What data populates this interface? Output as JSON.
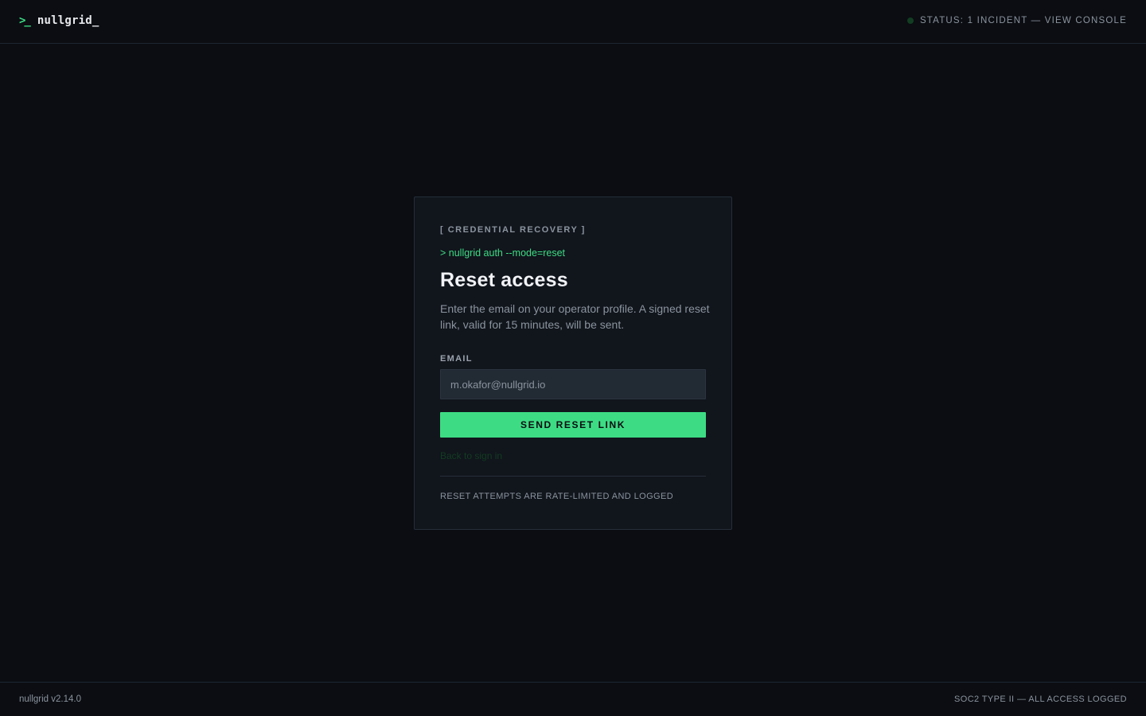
{
  "header": {
    "logo_icon": ">_",
    "logo_text": "nullgrid_",
    "status_text": "STATUS: 1 INCIDENT — VIEW CONSOLE",
    "status_icon": "status-dot-icon"
  },
  "card": {
    "eyebrow": "[ CREDENTIAL RECOVERY ]",
    "command": "> nullgrid auth --mode=reset",
    "title": "Reset access",
    "description": "Enter the email on your operator profile. A signed reset link, valid for 15 minutes, will be sent.",
    "email_label": "EMAIL",
    "email_value": "",
    "email_placeholder": "m.okafor@nullgrid.io",
    "submit_label": "SEND RESET LINK",
    "back_link": "Back to sign in",
    "note": "RESET ATTEMPTS ARE RATE-LIMITED AND LOGGED"
  },
  "footer": {
    "version": "nullgrid v2.14.0",
    "compliance": "SOC2 TYPE II — ALL ACCESS LOGGED"
  },
  "colors": {
    "background": "#0b0d12",
    "card": "#11151c",
    "accent": "#3ddc84",
    "muted_text": "#8b949e",
    "status_dot": "#123d22"
  }
}
